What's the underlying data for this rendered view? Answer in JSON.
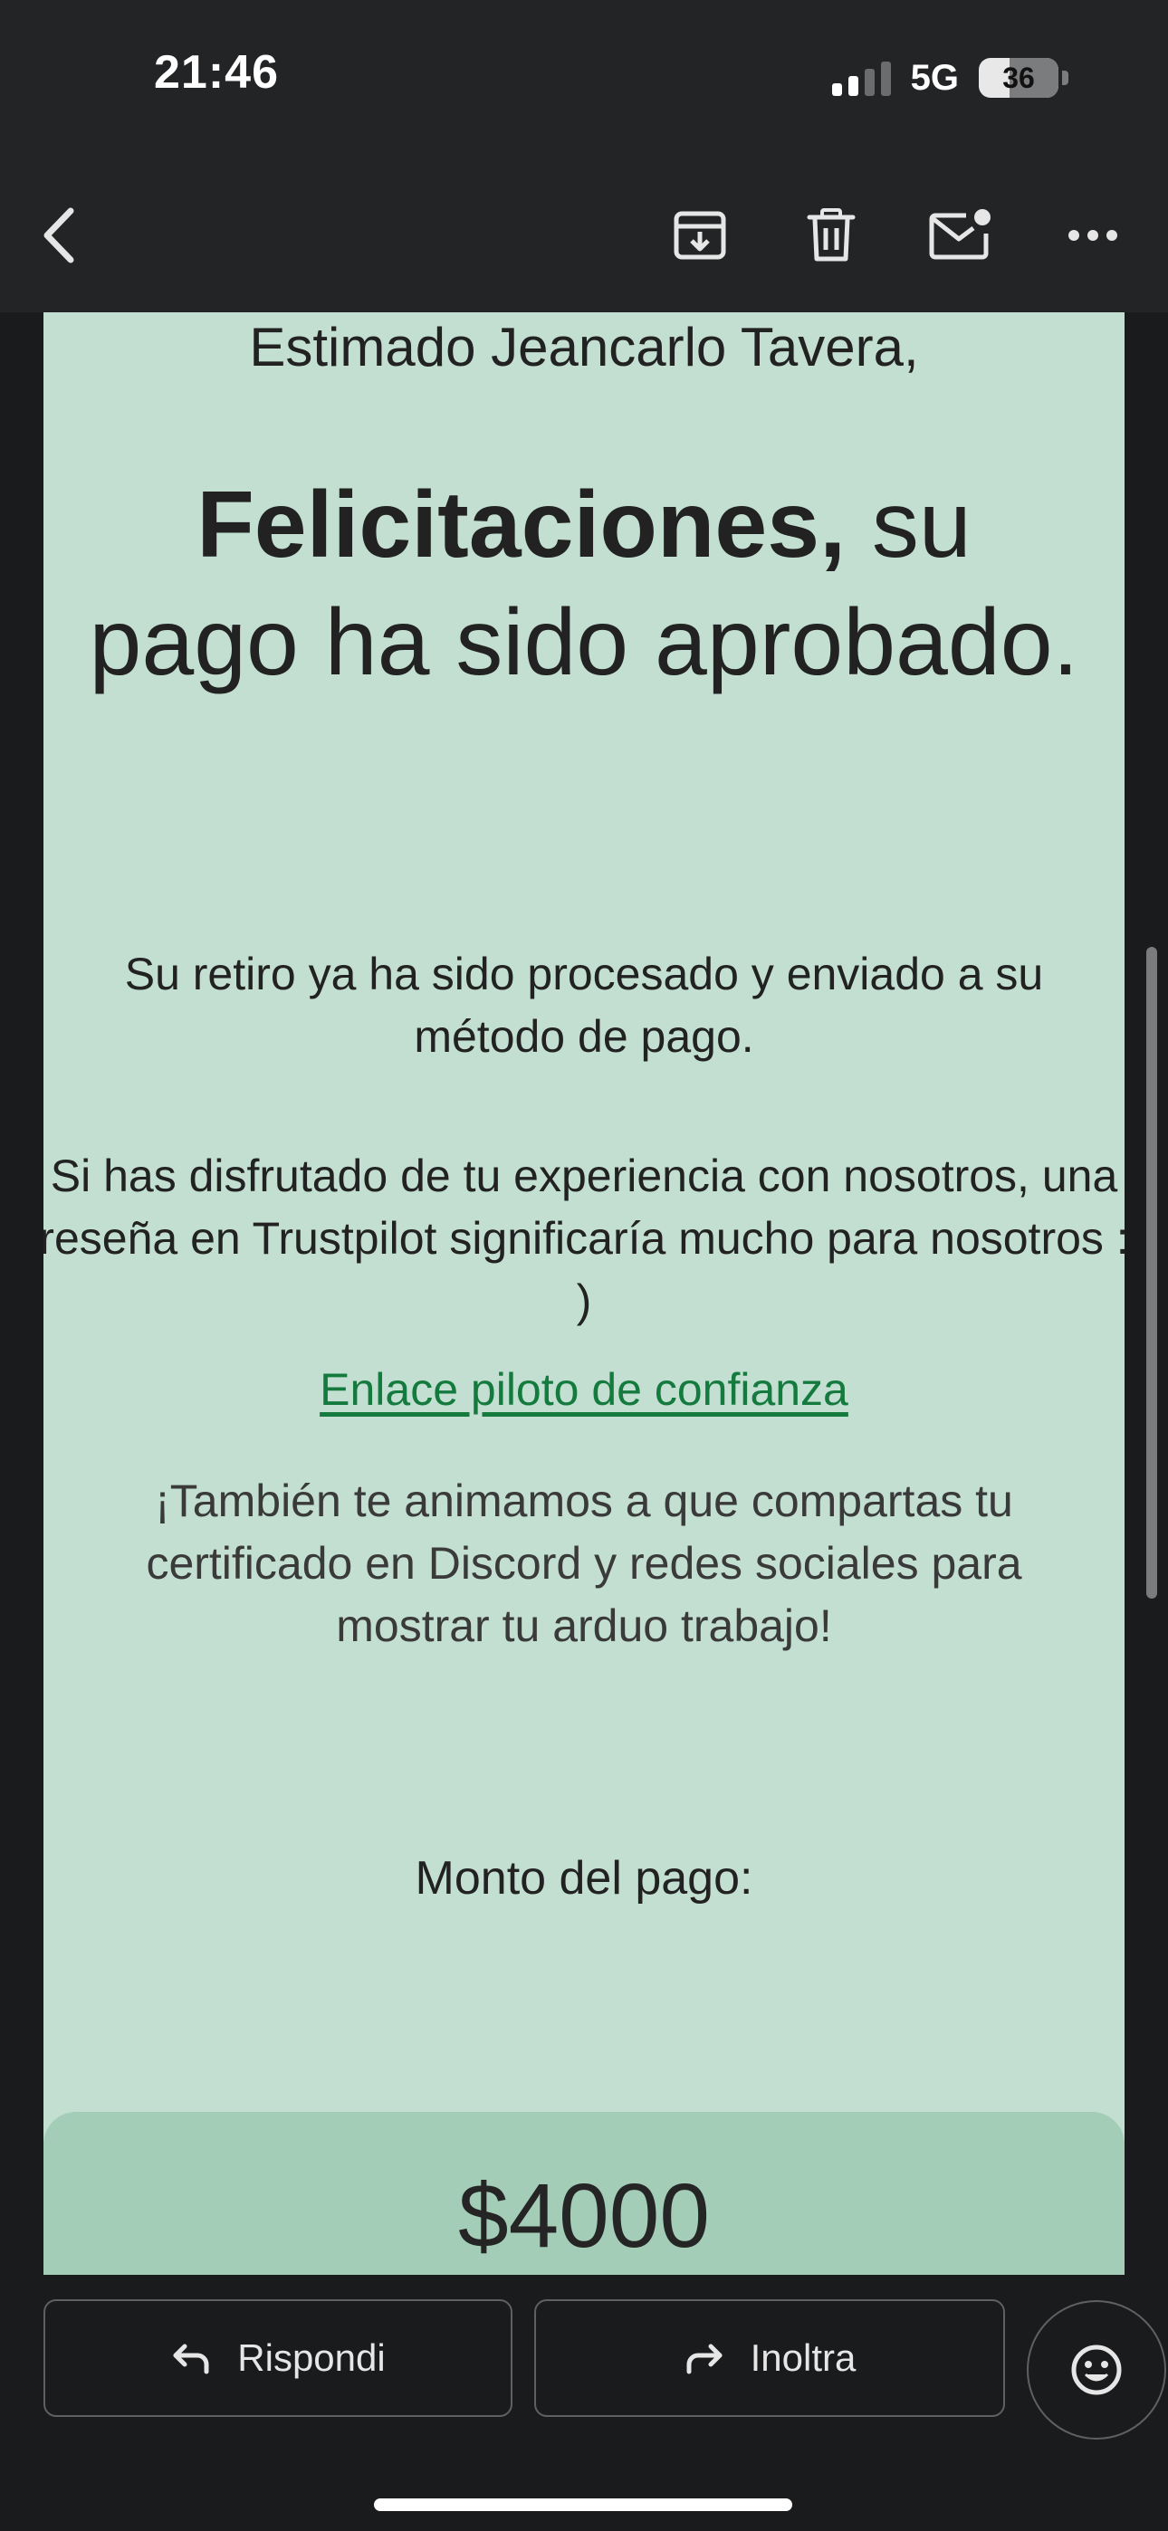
{
  "status_bar": {
    "time": "21:46",
    "network": "5G",
    "battery": "36"
  },
  "toolbar": {
    "back_icon": "chevron-left-icon",
    "archive_icon": "archive-icon",
    "delete_icon": "trash-icon",
    "mark_unread_icon": "mail-unread-icon",
    "more_icon": "more-icon"
  },
  "email": {
    "greeting": "Estimado Jeancarlo Tavera,",
    "headline_bold": "Felicitaciones,",
    "headline_rest_1": " su",
    "headline_rest_2": "pago ha sido aprobado.",
    "paragraph_1": "Su retiro ya ha sido procesado y enviado a su método de pago.",
    "paragraph_2": "Si has disfrutado de tu experiencia con nosotros, una reseña en Trustpilot significaría mucho para nosotros : )",
    "trustpilot_link": "Enlace piloto de confianza",
    "paragraph_3": "¡También te animamos a que compartas tu certificado en Discord y redes sociales para mostrar tu arduo trabajo!",
    "amount_label": "Monto del pago:",
    "amount": "$4000"
  },
  "actions": {
    "reply_label": "Rispondi",
    "forward_label": "Inoltra",
    "emoji_icon": "emoji-reaction-icon"
  },
  "colors": {
    "mail_background": "#c3dfd2",
    "amount_box": "#a3cdb6",
    "link": "#157a3e",
    "chrome": "#232425"
  }
}
